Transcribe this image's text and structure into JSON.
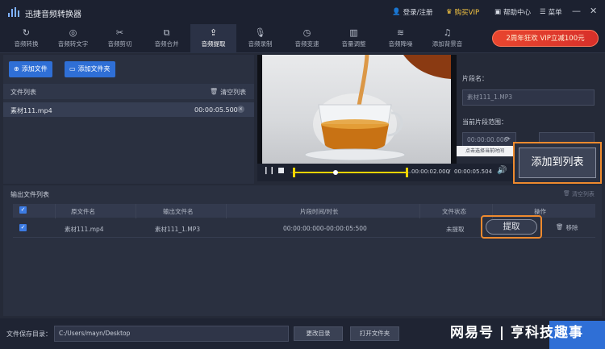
{
  "app": {
    "title": "迅捷音频转换器",
    "login": "登录/注册",
    "vip": "购买VIP",
    "help": "帮助中心",
    "menu": "菜单",
    "minimize": "—",
    "close": "✕"
  },
  "tabs": [
    {
      "label": "音频转换",
      "icon": "↻"
    },
    {
      "label": "音频转文字",
      "icon": "◎"
    },
    {
      "label": "音频剪切",
      "icon": "✂"
    },
    {
      "label": "音频合并",
      "icon": "⧉"
    },
    {
      "label": "音频提取",
      "icon": "⇪"
    },
    {
      "label": "音频录制",
      "icon": "🎙"
    },
    {
      "label": "音频变速",
      "icon": "◷"
    },
    {
      "label": "音量调整",
      "icon": "▥"
    },
    {
      "label": "音频降噪",
      "icon": "≋"
    },
    {
      "label": "添加背景音",
      "icon": "♫"
    }
  ],
  "active_tab": "音频提取",
  "promo": "2周年狂欢 VIP立减100元",
  "left": {
    "add_file": "添加文件",
    "add_folder": "添加文件夹",
    "file_list_label": "文件列表",
    "clear_list": "清空列表",
    "file_name": "素材111.mp4",
    "file_duration": "00:00:05.500"
  },
  "player": {
    "current_time": "00:00:02.000",
    "total_time": "00:00:05.504",
    "time_separator": "/"
  },
  "segment": {
    "name_label": "片段名：",
    "name_value": "素材111_1.MP3",
    "range_label": "当前片段范围：",
    "start_value": "00:00:00.000",
    "tooltip": "点击选择当前时间",
    "add_to_list": "添加到列表"
  },
  "output": {
    "title": "输出文件列表",
    "clear_list": "清空列表",
    "headers": [
      "原文件名",
      "输出文件名",
      "片段时间/时长",
      "文件状态",
      "操作"
    ],
    "row": {
      "source": "素材111.mp4",
      "output": "素材111_1.MP3",
      "time_range": "00:00:00:000-00:00:05:500",
      "status": "未提取",
      "extract": "提取",
      "remove": "移除"
    }
  },
  "bottom": {
    "save_dir_label": "文件保存目录：",
    "save_dir_value": "C:/Users/mayn/Desktop",
    "change_dir": "更改目录",
    "open_folder": "打开文件夹",
    "watermark": "网易号 | 亨科技趣事"
  },
  "colors": {
    "accent_blue": "#2f6fd6",
    "highlight_orange": "#ee8a2e",
    "promo_red": "#e8462f",
    "timeline_yellow": "#f5d400"
  }
}
